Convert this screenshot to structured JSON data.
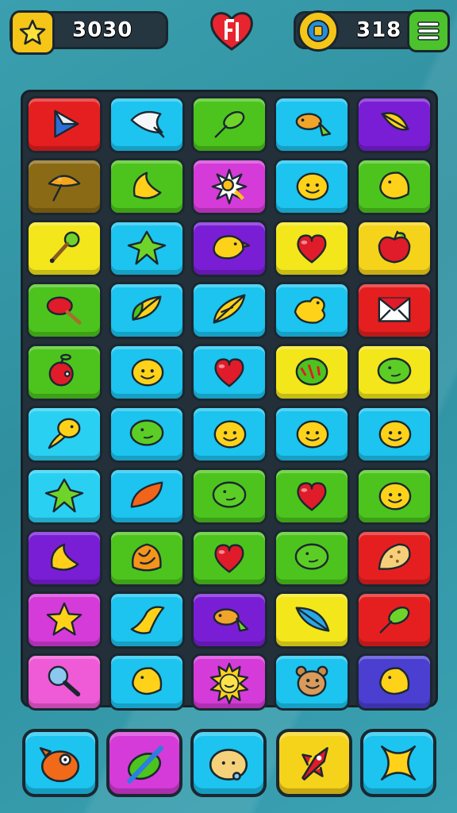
{
  "hud": {
    "score": "3030",
    "coins": "318",
    "score_icon": "star-icon",
    "coins_icon": "coin-icon",
    "lives_icon": "heart-icon",
    "menu_icon": "menu-icon"
  },
  "colors": {
    "red": "#e51f1f",
    "cyan": "#1cc4ef",
    "green": "#4cc41d",
    "purple": "#7a1ed6",
    "brown": "#8a6a14",
    "magenta": "#d53bd8",
    "yellow": "#f3e61a",
    "lightcyan": "#2ad0f2",
    "pink": "#ef5ad6",
    "indigo": "#4a3fd0",
    "yellowgold": "#f5d31a"
  },
  "board": {
    "rows": [
      [
        {
          "color": "red",
          "icon": "play-arrow"
        },
        {
          "color": "cyan",
          "icon": "white-bird"
        },
        {
          "color": "green",
          "icon": "green-leaf"
        },
        {
          "color": "cyan",
          "icon": "fish"
        },
        {
          "color": "purple",
          "icon": "yellow-leaf"
        }
      ],
      [
        {
          "color": "brown",
          "icon": "mushroom"
        },
        {
          "color": "green",
          "icon": "banana"
        },
        {
          "color": "magenta",
          "icon": "burst"
        },
        {
          "color": "cyan",
          "icon": "smiley"
        },
        {
          "color": "green",
          "icon": "lemon"
        }
      ],
      [
        {
          "color": "yellow",
          "icon": "rattle"
        },
        {
          "color": "cyan",
          "icon": "star-leaf"
        },
        {
          "color": "purple",
          "icon": "chick"
        },
        {
          "color": "yellow",
          "icon": "heart"
        },
        {
          "color": "yellowgold",
          "icon": "apple"
        }
      ],
      [
        {
          "color": "green",
          "icon": "red-pepper"
        },
        {
          "color": "cyan",
          "icon": "leaf-pair"
        },
        {
          "color": "cyan",
          "icon": "feather"
        },
        {
          "color": "cyan",
          "icon": "duck"
        },
        {
          "color": "red",
          "icon": "envelope"
        }
      ],
      [
        {
          "color": "green",
          "icon": "cherry"
        },
        {
          "color": "cyan",
          "icon": "smiley"
        },
        {
          "color": "cyan",
          "icon": "heart"
        },
        {
          "color": "yellow",
          "icon": "melon"
        },
        {
          "color": "yellow",
          "icon": "green-blob"
        }
      ],
      [
        {
          "color": "lightcyan",
          "icon": "tadpole"
        },
        {
          "color": "cyan",
          "icon": "green-blob"
        },
        {
          "color": "cyan",
          "icon": "smiley"
        },
        {
          "color": "cyan",
          "icon": "smiley"
        },
        {
          "color": "cyan",
          "icon": "smiley"
        }
      ],
      [
        {
          "color": "lightcyan",
          "icon": "star-leaf"
        },
        {
          "color": "cyan",
          "icon": "orange-leaf"
        },
        {
          "color": "green",
          "icon": "green-blob"
        },
        {
          "color": "green",
          "icon": "heart"
        },
        {
          "color": "green",
          "icon": "smiley"
        }
      ],
      [
        {
          "color": "purple",
          "icon": "banana"
        },
        {
          "color": "green",
          "icon": "croissant"
        },
        {
          "color": "green",
          "icon": "heart"
        },
        {
          "color": "green",
          "icon": "green-blob"
        },
        {
          "color": "red",
          "icon": "cookie"
        }
      ],
      [
        {
          "color": "magenta",
          "icon": "star"
        },
        {
          "color": "cyan",
          "icon": "bird-leaf"
        },
        {
          "color": "purple",
          "icon": "fish"
        },
        {
          "color": "yellow",
          "icon": "blue-leaf"
        },
        {
          "color": "red",
          "icon": "green-leaf"
        }
      ],
      [
        {
          "color": "pink",
          "icon": "magnifier"
        },
        {
          "color": "cyan",
          "icon": "lemon"
        },
        {
          "color": "magenta",
          "icon": "sun"
        },
        {
          "color": "cyan",
          "icon": "bear"
        },
        {
          "color": "indigo",
          "icon": "lemon"
        }
      ]
    ]
  },
  "dock": [
    {
      "color": "cyan",
      "icon": "fish-monster"
    },
    {
      "color": "magenta",
      "icon": "pencil-leaf"
    },
    {
      "color": "cyan",
      "icon": "face-blob"
    },
    {
      "color": "yellowgold",
      "icon": "rocket"
    },
    {
      "color": "cyan",
      "icon": "x-star"
    }
  ]
}
